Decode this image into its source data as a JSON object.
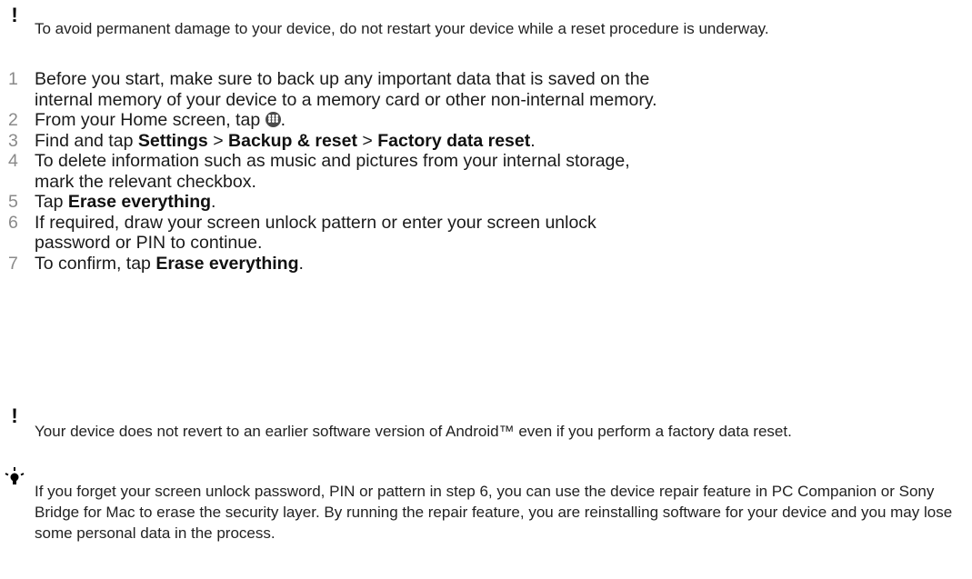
{
  "warning_top": {
    "icon": "exclamation-icon",
    "text": "To avoid permanent damage to your device, do not restart your device while a reset procedure is underway."
  },
  "steps": [
    {
      "num": "1",
      "text": "Before you start, make sure to back up any important data that is saved on the internal memory of your device to a memory card or other non-internal memory."
    },
    {
      "num": "2",
      "pre": "From your Home screen, tap ",
      "icon": "apps-icon",
      "post": "."
    },
    {
      "num": "3",
      "pre": "Find and tap ",
      "b1": "Settings",
      "sep1": " > ",
      "b2": "Backup & reset",
      "sep2": " > ",
      "b3": "Factory data reset",
      "post": "."
    },
    {
      "num": "4",
      "text": "To delete information such as music and pictures from your internal storage, mark the relevant checkbox."
    },
    {
      "num": "5",
      "pre": "Tap ",
      "b1": "Erase everything",
      "post": "."
    },
    {
      "num": "6",
      "text": "If required, draw your screen unlock pattern or enter your screen unlock password or PIN to continue."
    },
    {
      "num": "7",
      "pre": "To confirm, tap ",
      "b1": "Erase everything",
      "post": "."
    }
  ],
  "warning_bottom": {
    "icon": "exclamation-icon",
    "text": "Your device does not revert to an earlier software version of Android™ even if you perform a factory data reset."
  },
  "tip": {
    "icon": "lightbulb-icon",
    "text": "If you forget your screen unlock password, PIN or pattern in step 6, you can use the device repair feature in PC Companion or Sony Bridge for Mac to erase the security layer. By running the repair feature, you are reinstalling software for your device and you may lose some personal data in the process."
  }
}
